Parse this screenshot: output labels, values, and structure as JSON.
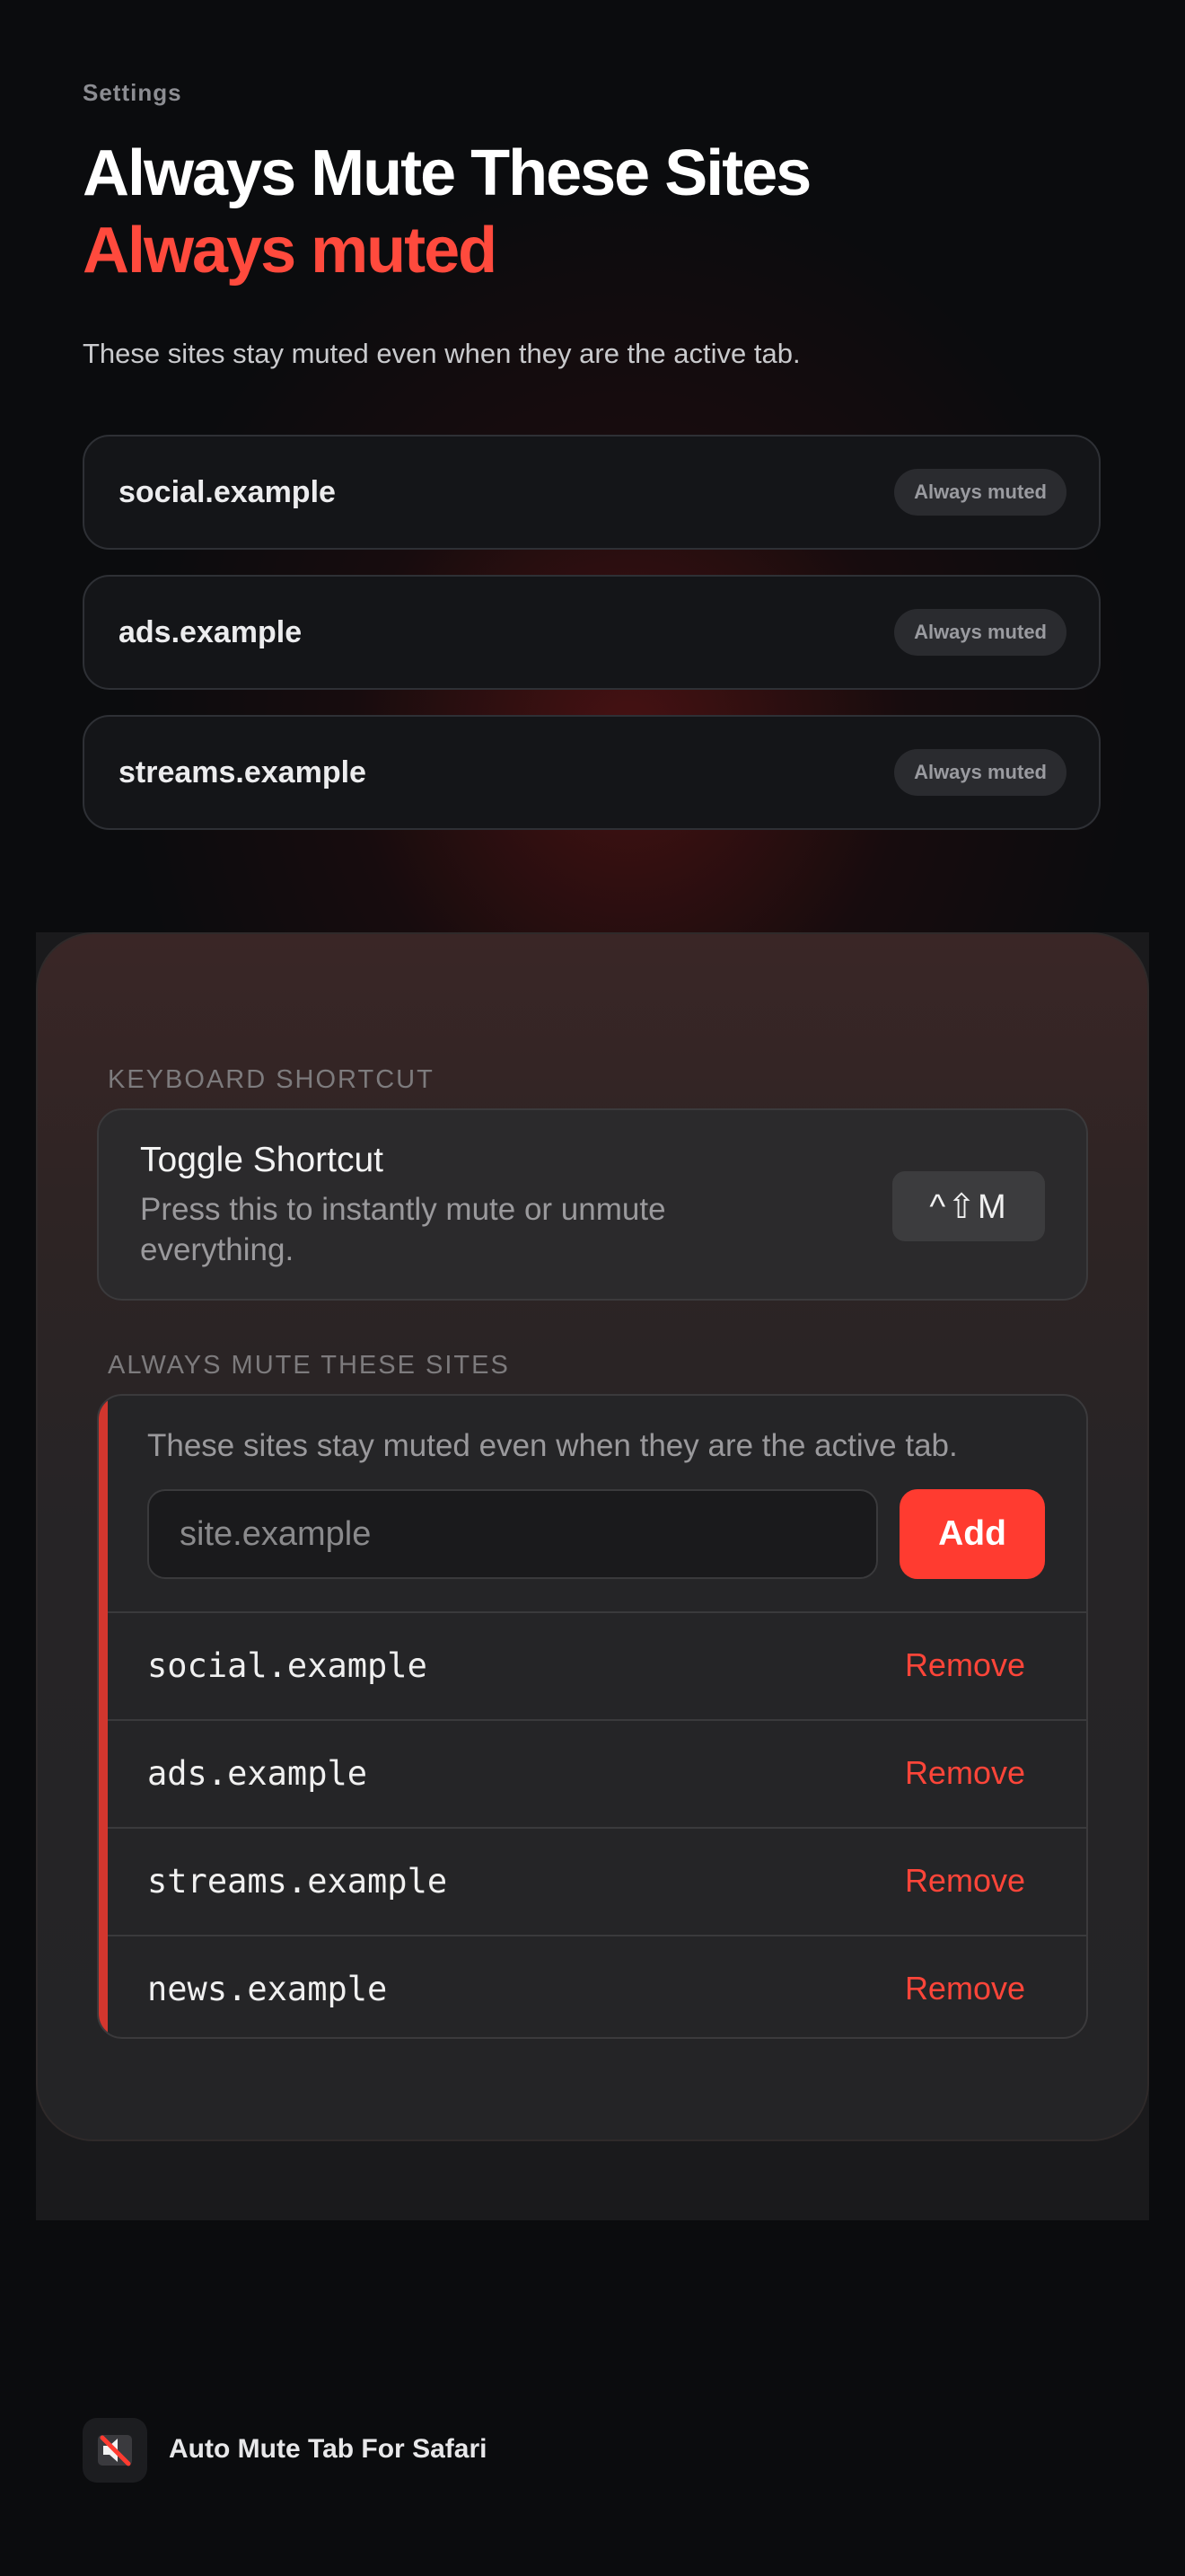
{
  "header": {
    "eyebrow": "Settings",
    "title": "Always Mute These Sites",
    "highlight": "Always muted",
    "subtitle": "These sites stay muted even when they are the active tab."
  },
  "preview_sites": [
    {
      "domain": "social.example",
      "badge": "Always muted"
    },
    {
      "domain": "ads.example",
      "badge": "Always muted"
    },
    {
      "domain": "streams.example",
      "badge": "Always muted"
    }
  ],
  "panel": {
    "keyboard_section": "KEYBOARD SHORTCUT",
    "shortcut_title": "Toggle Shortcut",
    "shortcut_desc": "Press this to instantly mute or unmute everything.",
    "shortcut_key": "^⇧M",
    "mute_section": "ALWAYS MUTE THESE SITES",
    "mute_desc": "These sites stay muted even when they are the active tab.",
    "input_placeholder": "site.example",
    "add_label": "Add",
    "sites": [
      {
        "domain": "social.example",
        "remove": "Remove"
      },
      {
        "domain": "ads.example",
        "remove": "Remove"
      },
      {
        "domain": "streams.example",
        "remove": "Remove"
      },
      {
        "domain": "news.example",
        "remove": "Remove"
      }
    ]
  },
  "footer": {
    "app_name": "Auto Mute Tab For Safari",
    "icon": "muted-speaker-icon"
  },
  "colors": {
    "accent": "#ff3b30",
    "background": "#0b0c0e"
  }
}
